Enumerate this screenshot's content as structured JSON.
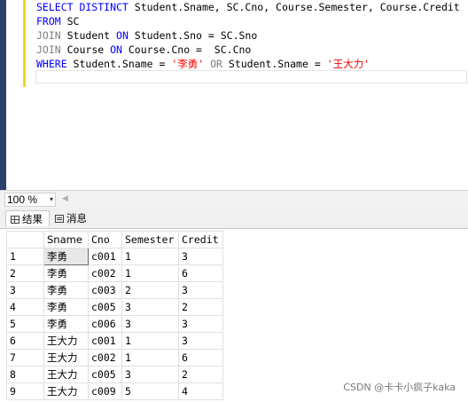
{
  "editor": {
    "line1": {
      "kw1": "SELECT DISTINCT",
      "rest": " Student.Sname, SC.Cno, Course.Semester, Course.Credit"
    },
    "line2": {
      "kw": "FROM",
      "rest": " SC"
    },
    "line3": {
      "kw": "JOIN",
      "t1": " Student ",
      "on": "ON",
      "rest": " Student.Sno = SC.Sno"
    },
    "line4": {
      "kw": "JOIN",
      "t1": " Course ",
      "on": "ON",
      "rest": " Course.Cno =  SC.Cno"
    },
    "line5": {
      "kw": "WHERE",
      "t1": " Student.Sname = ",
      "s1": "'李勇'",
      "or": " OR ",
      "t2": "Student.Sname = ",
      "s2": "'王大力'"
    }
  },
  "zoom": {
    "value": "100 %",
    "arrow": "▾",
    "scroll_left": "◀"
  },
  "tabs": [
    {
      "label": "结果",
      "icon": "grid-icon"
    },
    {
      "label": "消息",
      "icon": "message-icon"
    }
  ],
  "results": {
    "columns": [
      "Sname",
      "Cno",
      "Semester",
      "Credit"
    ],
    "rows": [
      [
        "1",
        "李勇",
        "c001",
        "1",
        "3"
      ],
      [
        "2",
        "李勇",
        "c002",
        "1",
        "6"
      ],
      [
        "3",
        "李勇",
        "c003",
        "2",
        "3"
      ],
      [
        "4",
        "李勇",
        "c005",
        "3",
        "2"
      ],
      [
        "5",
        "李勇",
        "c006",
        "3",
        "3"
      ],
      [
        "6",
        "王大力",
        "c001",
        "1",
        "3"
      ],
      [
        "7",
        "王大力",
        "c002",
        "1",
        "6"
      ],
      [
        "8",
        "王大力",
        "c005",
        "3",
        "2"
      ],
      [
        "9",
        "王大力",
        "c009",
        "5",
        "4"
      ]
    ]
  },
  "watermark": "CSDN @卡卡小疯子kaka"
}
